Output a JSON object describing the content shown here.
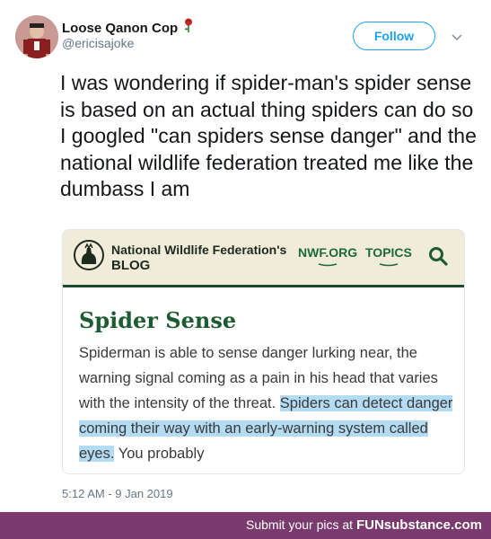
{
  "tweet": {
    "display_name": "Loose Qanon Cop",
    "handle": "@ericisajoke",
    "follow_label": "Follow",
    "text": "I was wondering if spider-man's spider sense is based on an actual thing spiders can do so I googled \"can spiders sense danger\" and the national wildlife federation treated me like the dumbass I am",
    "timestamp": "5:12 AM - 9 Jan 2019",
    "icons": {
      "avatar": "avatar",
      "name_emoji": "rose-icon",
      "more": "chevron-down-icon"
    }
  },
  "card": {
    "blog_title_line1": "National Wildlife Federation's",
    "blog_title_line2": "BLOG",
    "nav_nwf": "NWF.ORG",
    "nav_topics": "TOPICS",
    "search_icon": "search-icon",
    "logo_icon": "nwf-logo-icon",
    "article_title": "Spider Sense",
    "excerpt_plain": "Spiderman is able to sense danger lurking near, the warning signal coming as a pain in his head that varies with the intensity of the threat. ",
    "excerpt_highlighted": "Spiders can detect danger coming their way with an early-warning system called eyes.",
    "excerpt_tail": " You probably"
  },
  "footer": {
    "lead": "Submit your pics at",
    "brand_prefix": "FUN",
    "brand_suffix": "substance.com"
  },
  "colors": {
    "accent": "#1da1f2",
    "nwf_green": "#1d5c32",
    "highlight": "#b3dbf2",
    "footer_bg": "#7a3a6d"
  }
}
